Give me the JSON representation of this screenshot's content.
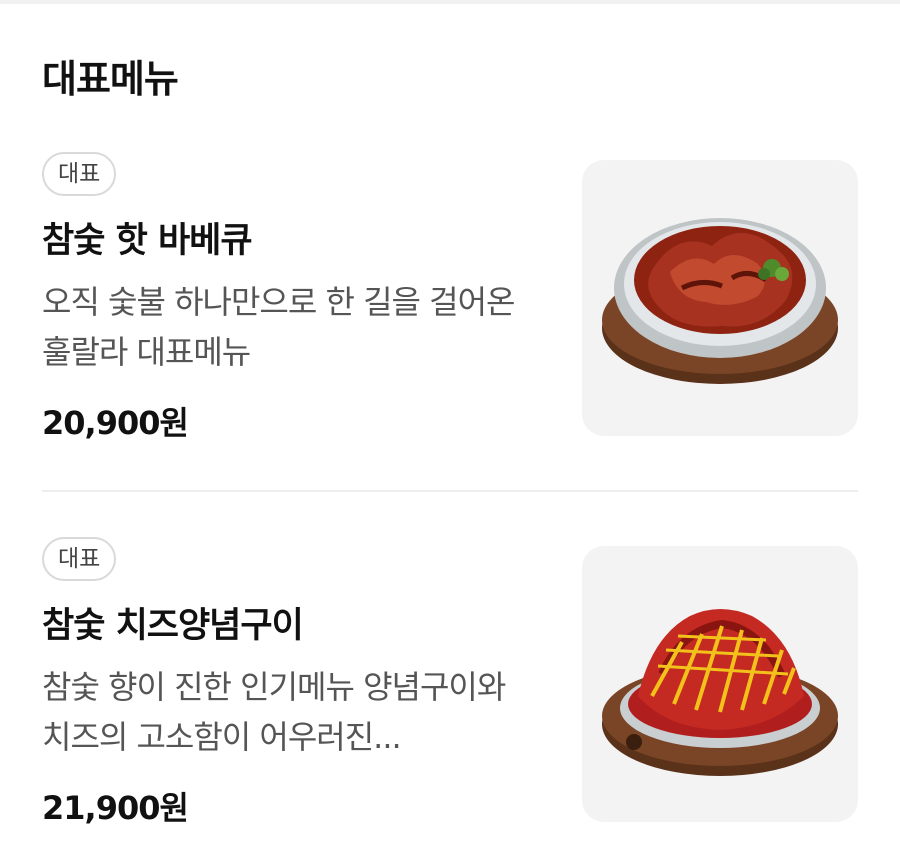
{
  "section": {
    "title": "대표메뉴"
  },
  "items": [
    {
      "badge": "대표",
      "name": "참숯 핫 바베큐",
      "description": "오직 숯불 하나만으로 한 길을 걸어온 훌랄라 대표메뉴",
      "price": "20,900원",
      "image_icon": "bbq-dish-image"
    },
    {
      "badge": "대표",
      "name": "참숯 치즈양념구이",
      "description": "참숯 향이 진한 인기메뉴 양념구이와 치즈의 고소함이 어우러진...",
      "price": "21,900원",
      "image_icon": "cheese-yangnyeom-dish-image"
    }
  ],
  "colors": {
    "text": "#111111",
    "muted": "#555555",
    "badge_border": "#d9d9d9",
    "thumb_bg": "#f3f3f3"
  }
}
